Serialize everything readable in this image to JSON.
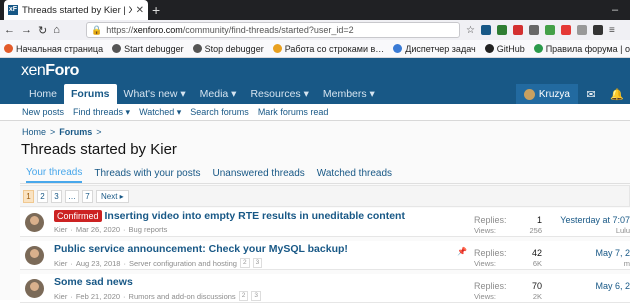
{
  "browser": {
    "tab_title": "Threads started by Kier | XenForo",
    "url_prefix": "https://",
    "url_domain": "xenforo.com",
    "url_path": "/community/find-threads/started?user_id=2",
    "bookmarks": [
      {
        "label": "Начальная страница",
        "color": "#e25b2a"
      },
      {
        "label": "Start debugger",
        "color": "#555555"
      },
      {
        "label": "Stop debugger",
        "color": "#555555"
      },
      {
        "label": "Работа со строками в…",
        "color": "#e8a020"
      },
      {
        "label": "Диспетчер задач",
        "color": "#3a7bd5"
      },
      {
        "label": "GitHub",
        "color": "#222222"
      },
      {
        "label": "Правила форума | ot…",
        "color": "#2b9a4b"
      }
    ]
  },
  "site": {
    "logo_a": "xen",
    "logo_b": "Foro"
  },
  "nav": {
    "items": [
      {
        "label": "Home"
      },
      {
        "label": "Forums"
      },
      {
        "label": "What's new ▾"
      },
      {
        "label": "Media ▾"
      },
      {
        "label": "Resources ▾"
      },
      {
        "label": "Members ▾"
      }
    ],
    "username": "Kruzya"
  },
  "subnav": [
    "New posts",
    "Find threads ▾",
    "Watched ▾",
    "Search forums",
    "Mark forums read"
  ],
  "breadcrumb": {
    "home": "Home",
    "sep": ">",
    "forums": "Forums",
    "sep2": ">"
  },
  "page_title": "Threads started by Kier",
  "tabs": [
    "Your threads",
    "Threads with your posts",
    "Unanswered threads",
    "Watched threads"
  ],
  "pager": {
    "pages": [
      "1",
      "2",
      "3",
      "…",
      "7"
    ],
    "next": "Next ▸"
  },
  "threads": [
    {
      "prefix": "Confirmed",
      "title": "Inserting video into empty RTE results in uneditable content",
      "author": "Kier",
      "date": "Mar 26, 2020",
      "forum": "Bug reports",
      "pages": [],
      "replies_label": "Replies:",
      "replies": "1",
      "views_label": "Views:",
      "views": "256",
      "last_date": "Yesterday at 7:07",
      "last_user": "Lulu"
    },
    {
      "prefix": "",
      "title": "Public service announcement: Check your MySQL backup!",
      "author": "Kier",
      "date": "Aug 23, 2018",
      "forum": "Server configuration and hosting",
      "pages": [
        "2",
        "3"
      ],
      "replies_label": "Replies:",
      "replies": "42",
      "views_label": "Views:",
      "views": "6K",
      "last_date": "May 7, 2",
      "last_user": "m"
    },
    {
      "prefix": "",
      "title": "Some sad news",
      "author": "Kier",
      "date": "Feb 21, 2020",
      "forum": "Rumors and add-on discussions",
      "pages": [
        "2",
        "3"
      ],
      "replies_label": "Replies:",
      "replies": "70",
      "views_label": "Views:",
      "views": "2K",
      "last_date": "May 6, 2",
      "last_user": ""
    }
  ]
}
